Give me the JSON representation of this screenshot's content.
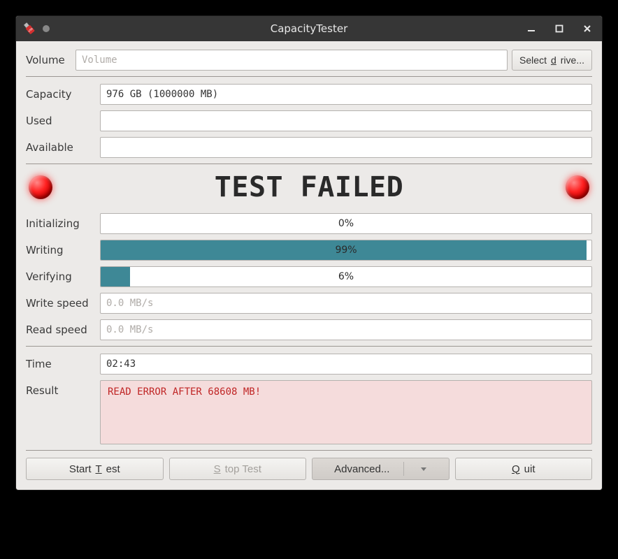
{
  "window": {
    "title": "CapacityTester"
  },
  "volume": {
    "label": "Volume",
    "placeholder": "Volume",
    "value": "",
    "select_drive_label": "Select drive..."
  },
  "capacity": {
    "label": "Capacity",
    "value": "976 GB (1000000 MB)",
    "used_label": "Used",
    "used_value": "",
    "available_label": "Available",
    "available_value": ""
  },
  "status": {
    "text": "TEST FAILED",
    "led_color": "#ff2222"
  },
  "progress": {
    "initializing": {
      "label": "Initializing",
      "percent": 0,
      "text": "0%"
    },
    "writing": {
      "label": "Writing",
      "percent": 99,
      "text": "99%"
    },
    "verifying": {
      "label": "Verifying",
      "percent": 6,
      "text": "6%"
    }
  },
  "speed": {
    "write_label": "Write speed",
    "write_value": "0.0 MB/s",
    "read_label": "Read speed",
    "read_value": "0.0 MB/s"
  },
  "time": {
    "label": "Time",
    "value": "02:43"
  },
  "result": {
    "label": "Result",
    "text": "READ ERROR AFTER 68608 MB!"
  },
  "buttons": {
    "start": "Start Test",
    "stop": "Stop Test",
    "advanced": "Advanced...",
    "quit": "Quit"
  }
}
